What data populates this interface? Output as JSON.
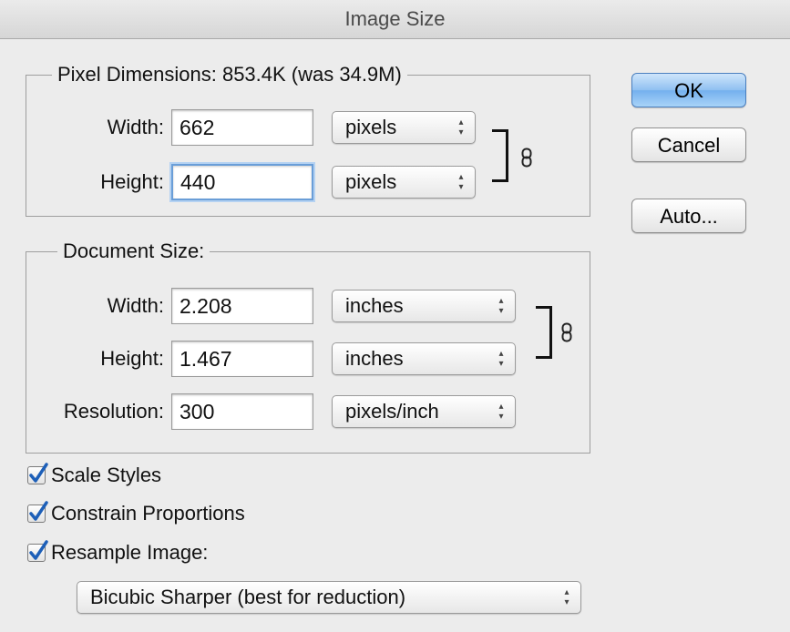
{
  "window": {
    "title": "Image Size"
  },
  "pixel_dimensions": {
    "legend": "Pixel Dimensions:  853.4K (was 34.9M)",
    "width_label": "Width:",
    "width_value": "662",
    "width_unit": "pixels",
    "height_label": "Height:",
    "height_value": "440",
    "height_unit": "pixels"
  },
  "document_size": {
    "legend": "Document Size:",
    "width_label": "Width:",
    "width_value": "2.208",
    "width_unit": "inches",
    "height_label": "Height:",
    "height_value": "1.467",
    "height_unit": "inches",
    "resolution_label": "Resolution:",
    "resolution_value": "300",
    "resolution_unit": "pixels/inch"
  },
  "buttons": {
    "ok": "OK",
    "cancel": "Cancel",
    "auto": "Auto..."
  },
  "options": {
    "scale_styles": "Scale Styles",
    "constrain_proportions": "Constrain Proportions",
    "resample_image": "Resample Image:",
    "resample_method": "Bicubic Sharper (best for reduction)"
  },
  "icons": {
    "chain": "chain-link-icon",
    "check": "checkmark-icon",
    "arrows": "up-down-arrows-icon"
  },
  "colors": {
    "default_button": "#8fc0f1",
    "focus_ring": "#6a9ed8",
    "checkmark": "#1d5fb8"
  }
}
